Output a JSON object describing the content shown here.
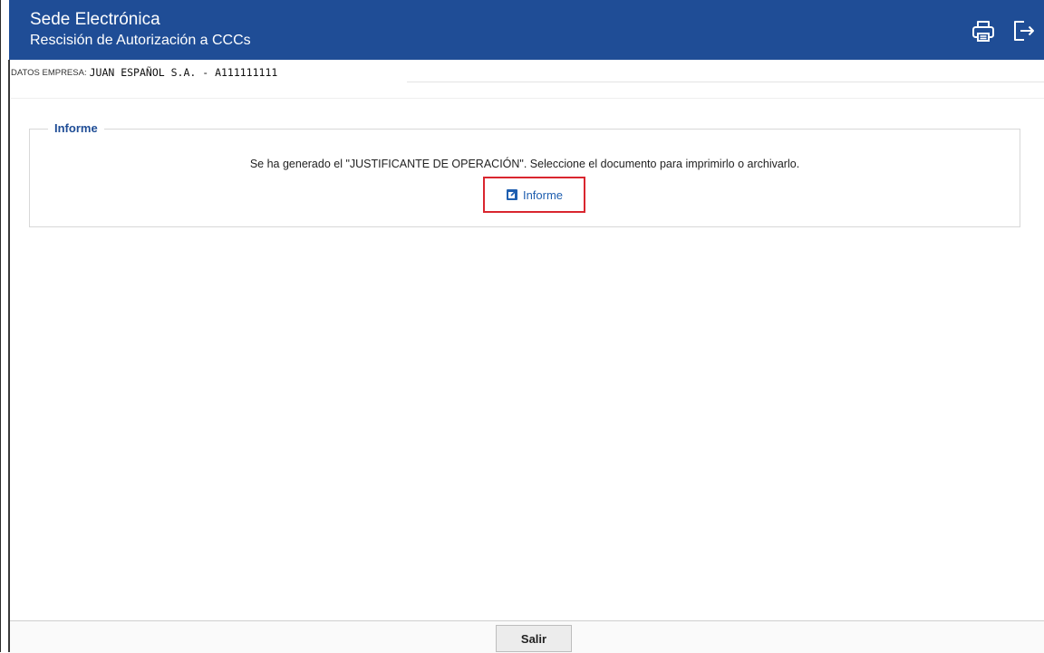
{
  "header": {
    "title": "Sede Electrónica",
    "subtitle": "Rescisión de Autorización a CCCs",
    "background_color": "#1f4d96",
    "icons": [
      "printer-icon",
      "logout-icon"
    ]
  },
  "empresa": {
    "label": "DATOS EMPRESA:",
    "value": "JUAN ESPAÑOL S.A. - A111111111"
  },
  "informe_section": {
    "legend": "Informe",
    "message": "Se ha generado el \"JUSTIFICANTE DE OPERACIÓN\". Seleccione el documento para imprimirlo o archivarlo.",
    "link_label": "Informe",
    "link_icon": "external-link-icon",
    "highlight_color": "#d9262f"
  },
  "footer": {
    "salir_label": "Salir"
  }
}
